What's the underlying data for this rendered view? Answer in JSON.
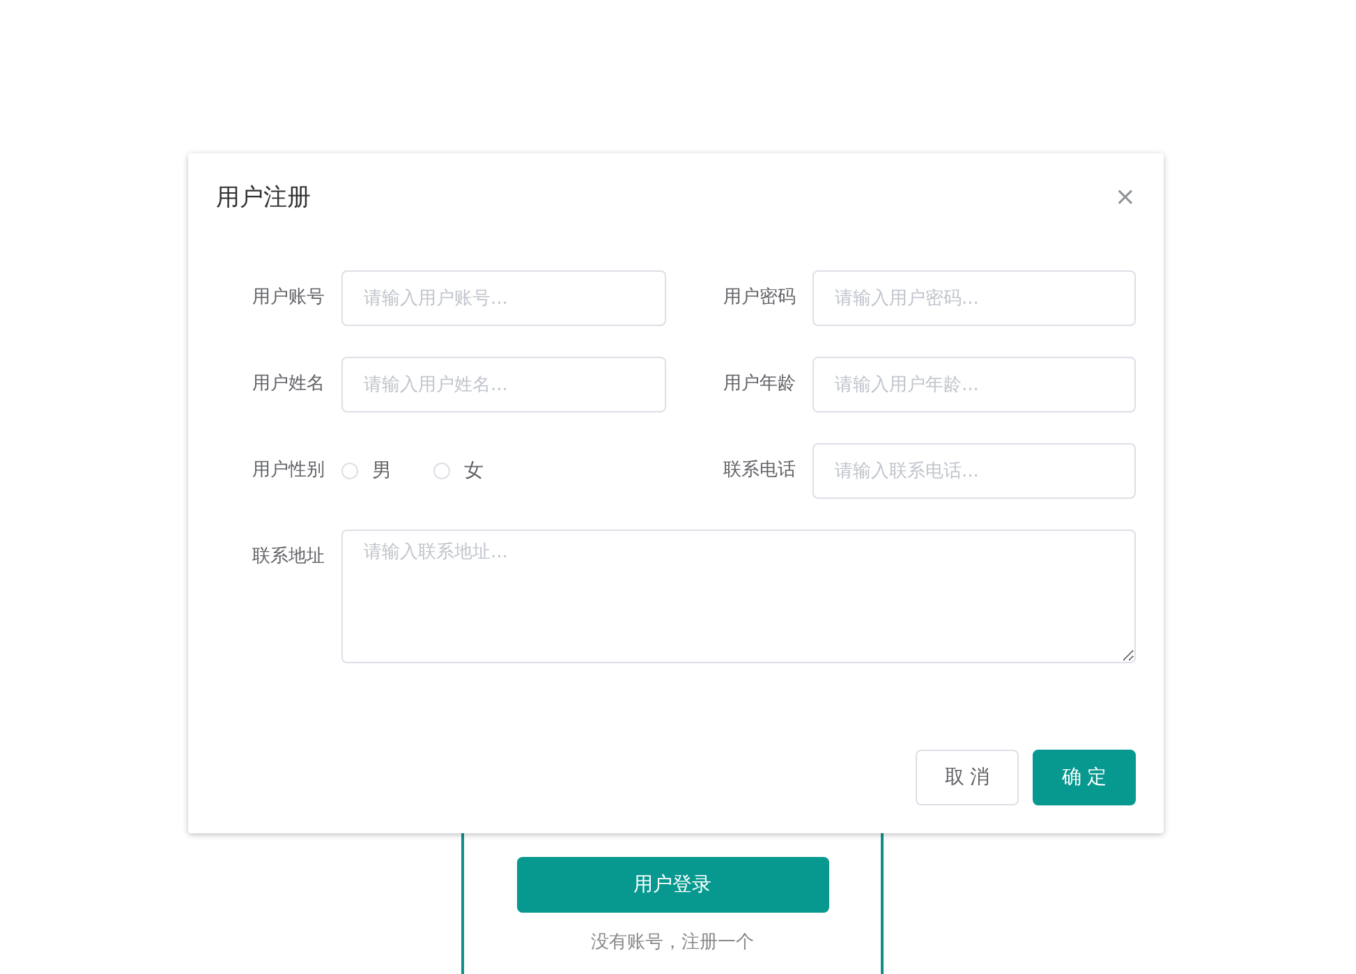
{
  "login_card": {
    "login_button": "用户登录",
    "register_link": "没有账号，注册一个"
  },
  "dialog": {
    "title": "用户注册",
    "close": "×",
    "fields": [
      {
        "kind": "input",
        "label": "用户账号",
        "placeholder": "请输入用户账号..."
      },
      {
        "kind": "input",
        "label": "用户密码",
        "placeholder": "请输入用户密码..."
      },
      {
        "kind": "input",
        "label": "用户姓名",
        "placeholder": "请输入用户姓名..."
      },
      {
        "kind": "input",
        "label": "用户年龄",
        "placeholder": "请输入用户年龄..."
      },
      {
        "kind": "radio",
        "label": "用户性别",
        "options": [
          {
            "label": "男",
            "selected": false
          },
          {
            "label": "女",
            "selected": false
          }
        ]
      },
      {
        "kind": "input",
        "label": "联系电话",
        "placeholder": "请输入联系电话..."
      },
      {
        "kind": "textarea",
        "label": "联系地址",
        "placeholder": "请输入联系地址..."
      }
    ],
    "buttons": [
      {
        "kind": "secondary",
        "label": "取 消"
      },
      {
        "kind": "primary",
        "label": "确 定"
      }
    ]
  }
}
